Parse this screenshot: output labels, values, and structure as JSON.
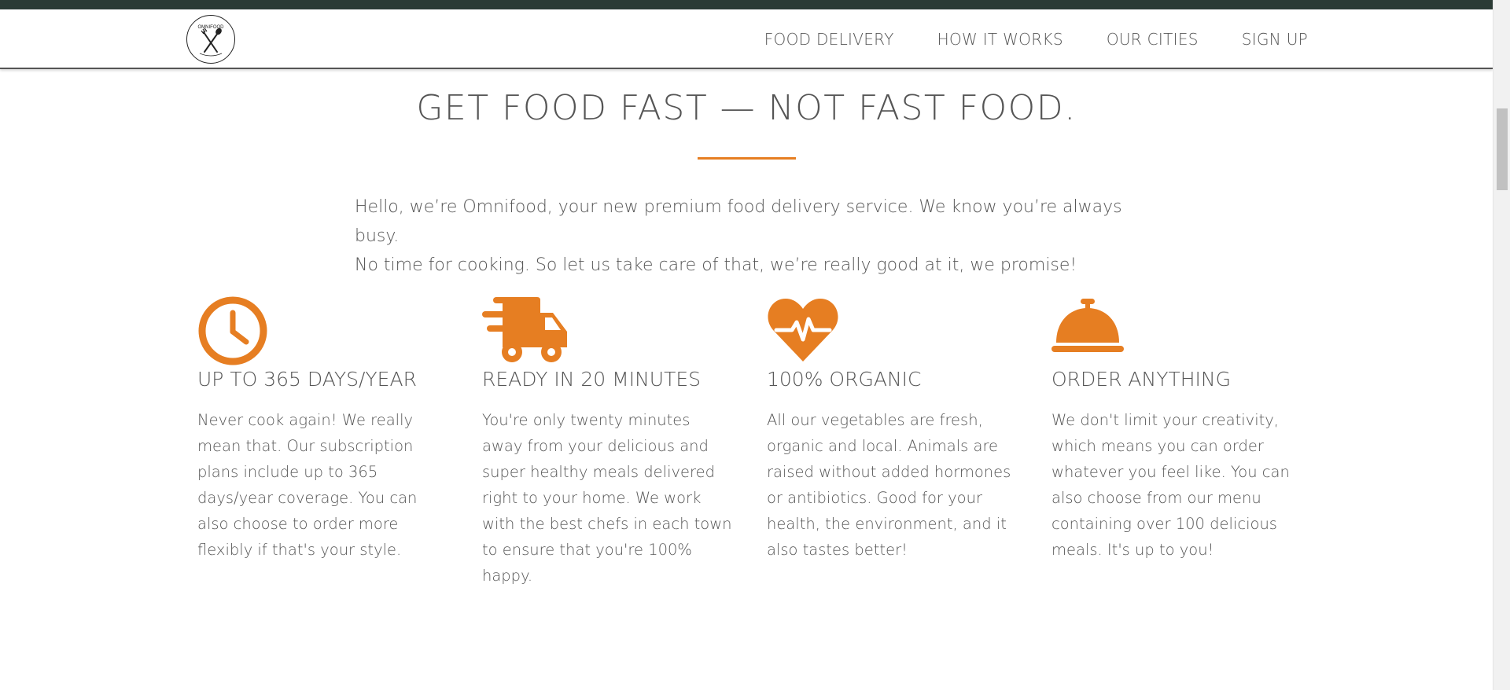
{
  "nav": {
    "logo_text": "OMNIFOOD",
    "links": [
      {
        "label": "FOOD DELIVERY"
      },
      {
        "label": "HOW IT WORKS"
      },
      {
        "label": "OUR CITIES"
      },
      {
        "label": "SIGN UP"
      }
    ]
  },
  "section": {
    "headline": "GET FOOD FAST — NOT FAST FOOD.",
    "intro_line1": "Hello, we’re Omnifood, your new premium food delivery service. We know you’re always busy.",
    "intro_line2": "No time for cooking. So let us take care of that, we’re really good at it, we promise!"
  },
  "features": [
    {
      "icon": "clock-icon",
      "title": "UP TO 365 DAYS/YEAR",
      "text": "Never cook again! We really mean that. Our subscription plans include up to 365 days/year coverage. You can also choose to order more flexibly if that's your style."
    },
    {
      "icon": "delivery-truck-icon",
      "title": "READY IN 20 MINUTES",
      "text": "You're only twenty minutes away from your delicious and super healthy meals delivered right to your home. We work with the best chefs in each town to ensure that you're 100% happy."
    },
    {
      "icon": "heartbeat-icon",
      "title": "100% ORGANIC",
      "text": "All our vegetables are fresh, organic and local. Animals are raised without added hormones or antibiotics. Good for your health, the environment, and it also tastes better!"
    },
    {
      "icon": "service-bell-icon",
      "title": "ORDER ANYTHING",
      "text": "We don't limit your creativity, which means you can order whatever you feel like. You can also choose from our menu containing over 100 delicious meals. It's up to you!"
    }
  ],
  "colors": {
    "accent": "#e67e22",
    "text": "#555555",
    "topbar": "#2b3b35"
  }
}
